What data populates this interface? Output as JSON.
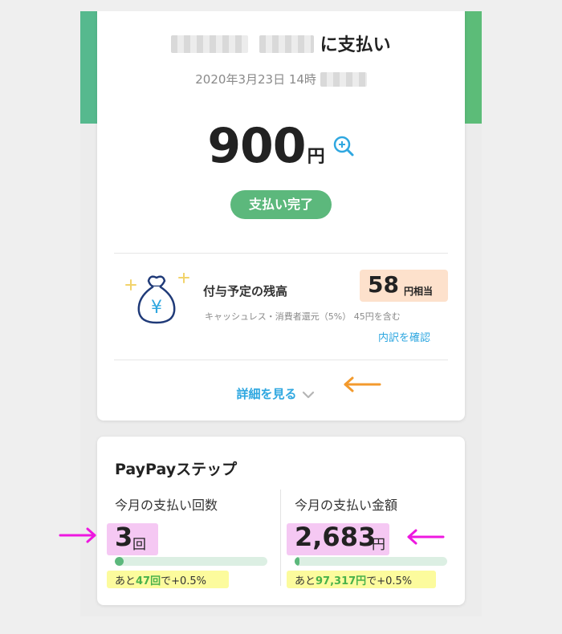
{
  "payment": {
    "title_suffix": "に支払い",
    "datetime": "2020年3月23日 14時",
    "amount": "900",
    "currency": "円",
    "status": "支払い完了"
  },
  "balance": {
    "label": "付与予定の残高",
    "value": "58",
    "unit": "円相当",
    "note": "キャッシュレス・消費者還元（5%） 45円を含む",
    "link": "内訳を確認"
  },
  "details_link": "詳細を見る",
  "step": {
    "title": "PayPayステップ",
    "count": {
      "label": "今月の支払い回数",
      "value": "3",
      "unit": "回",
      "progress": 0.06,
      "remaining_prefix": "あと",
      "remaining_value": "47回",
      "remaining_suffix": "で+0.5%"
    },
    "amount": {
      "label": "今月の支払い金額",
      "value": "2,683",
      "unit": "円",
      "progress": 0.03,
      "remaining_prefix": "あと",
      "remaining_value": "97,317円",
      "remaining_suffix": "で+0.5%"
    }
  },
  "colors": {
    "brand_green": "#5cb87c",
    "link_blue": "#2fa7e0",
    "annotation_orange": "#f39a2d",
    "annotation_magenta": "#ee18e0"
  },
  "icons": [
    "zoom-in-icon",
    "money-bag-icon",
    "chevron-down-icon",
    "arrow-left-icon",
    "arrow-right-icon"
  ]
}
